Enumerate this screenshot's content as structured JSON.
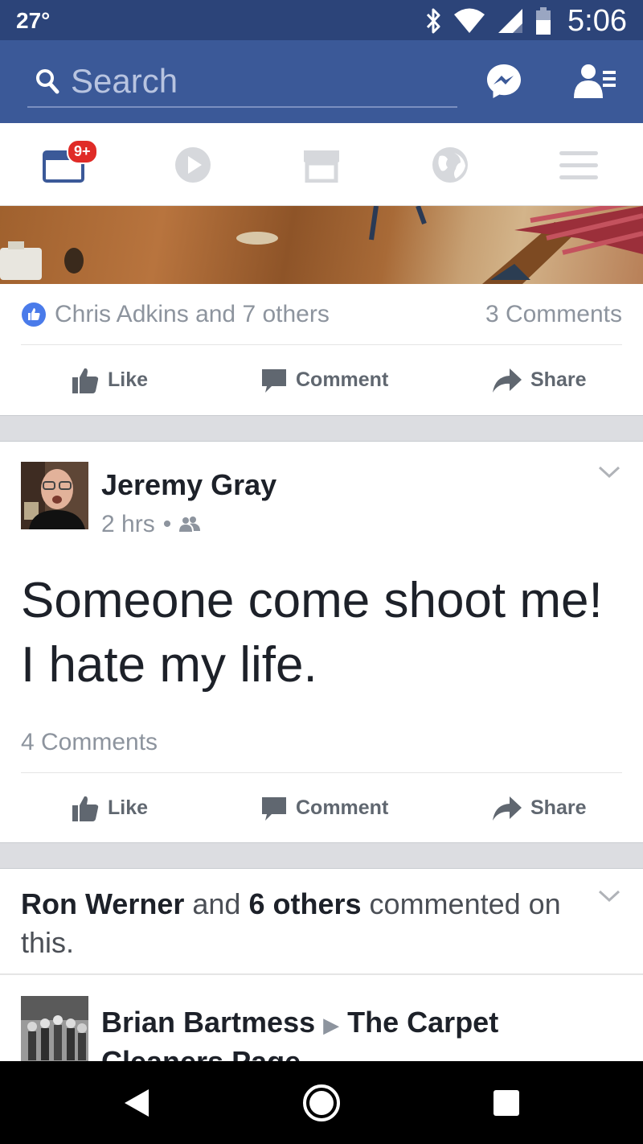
{
  "status_bar": {
    "temperature": "27°",
    "time": "5:06"
  },
  "header": {
    "search_placeholder": "Search"
  },
  "tabs": {
    "notifications_badge": "9+"
  },
  "post1": {
    "reactions": "Chris Adkins and 7 others",
    "comments_count": "3 Comments",
    "actions": {
      "like": "Like",
      "comment": "Comment",
      "share": "Share"
    }
  },
  "post2": {
    "author": "Jeremy Gray",
    "time": "2 hrs",
    "text": "Someone come shoot me! I hate my life.",
    "comments_count": "4 Comments",
    "actions": {
      "like": "Like",
      "comment": "Comment",
      "share": "Share"
    }
  },
  "post3": {
    "notif_name": "Ron Werner",
    "notif_and": "and",
    "notif_others": "6 others",
    "notif_rest": "commented on this.",
    "author": "Brian Bartmess",
    "arrow": "▶",
    "target_page": "The Carpet Cleaners Page"
  },
  "colors": {
    "brand_blue": "#3b5998",
    "status_bar": "#2c4479",
    "meta_gray": "#8d949e",
    "badge_red": "#e02b27"
  }
}
